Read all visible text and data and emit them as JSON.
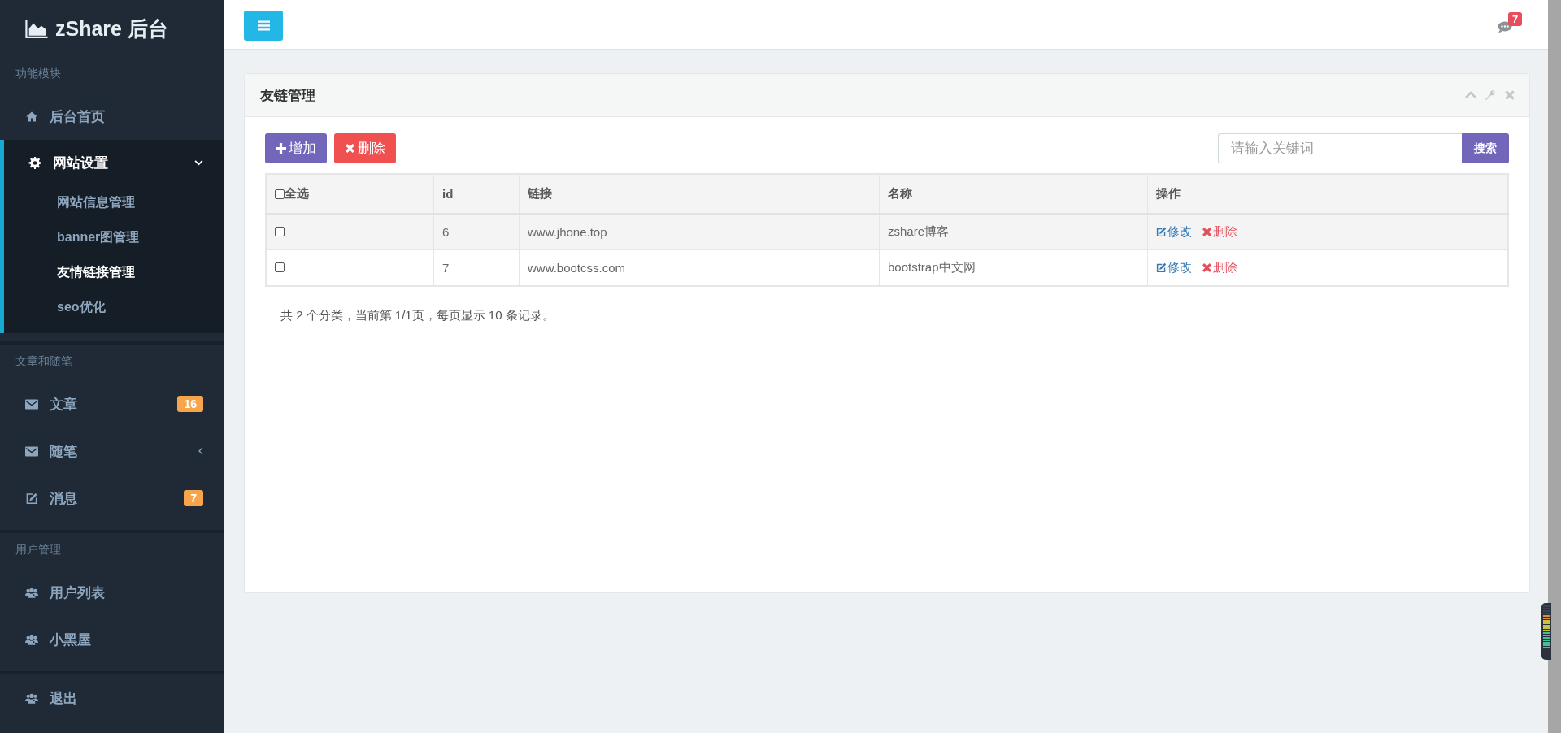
{
  "sidebar": {
    "logo": "zShare 后台",
    "sections": [
      {
        "label": "功能模块",
        "items": [
          {
            "label": "后台首页"
          },
          {
            "label": "网站设置",
            "expanded": true,
            "children": [
              {
                "label": "网站信息管理",
                "selected": false
              },
              {
                "label": "banner图管理",
                "selected": false
              },
              {
                "label": "友情链接管理",
                "selected": true
              },
              {
                "label": "seo优化",
                "selected": false
              }
            ]
          }
        ]
      },
      {
        "label": "文章和随笔",
        "items": [
          {
            "label": "文章",
            "badge": "16"
          },
          {
            "label": "随笔",
            "expanded": false
          },
          {
            "label": "消息",
            "badge": "7"
          }
        ]
      },
      {
        "label": "用户管理",
        "items": [
          {
            "label": "用户列表"
          },
          {
            "label": "小黑屋"
          }
        ]
      },
      {
        "items": [
          {
            "label": "退出"
          }
        ]
      }
    ]
  },
  "header": {
    "notification_count": "7"
  },
  "panel": {
    "title": "友链管理",
    "buttons": [
      {
        "label": "增加",
        "kind": "add"
      },
      {
        "label": "删除",
        "kind": "delete"
      }
    ],
    "search": {
      "placeholder": "请输入关键词",
      "button": "搜索"
    },
    "table": {
      "select_all": {
        "label": "全选",
        "checked": false
      },
      "columns": [
        "id",
        "链接",
        "名称",
        "操作"
      ],
      "rows": [
        {
          "checked": false,
          "id": "6",
          "link": "www.jhone.top",
          "name": "zshare博客",
          "actions": [
            "修改",
            "删除"
          ]
        },
        {
          "checked": false,
          "id": "7",
          "link": "www.bootcss.com",
          "name": "bootstrap中文网",
          "actions": [
            "修改",
            "删除"
          ]
        }
      ]
    },
    "footer": "共 2 个分类，当前第 1/1页，每页显示 10 条记录。"
  }
}
